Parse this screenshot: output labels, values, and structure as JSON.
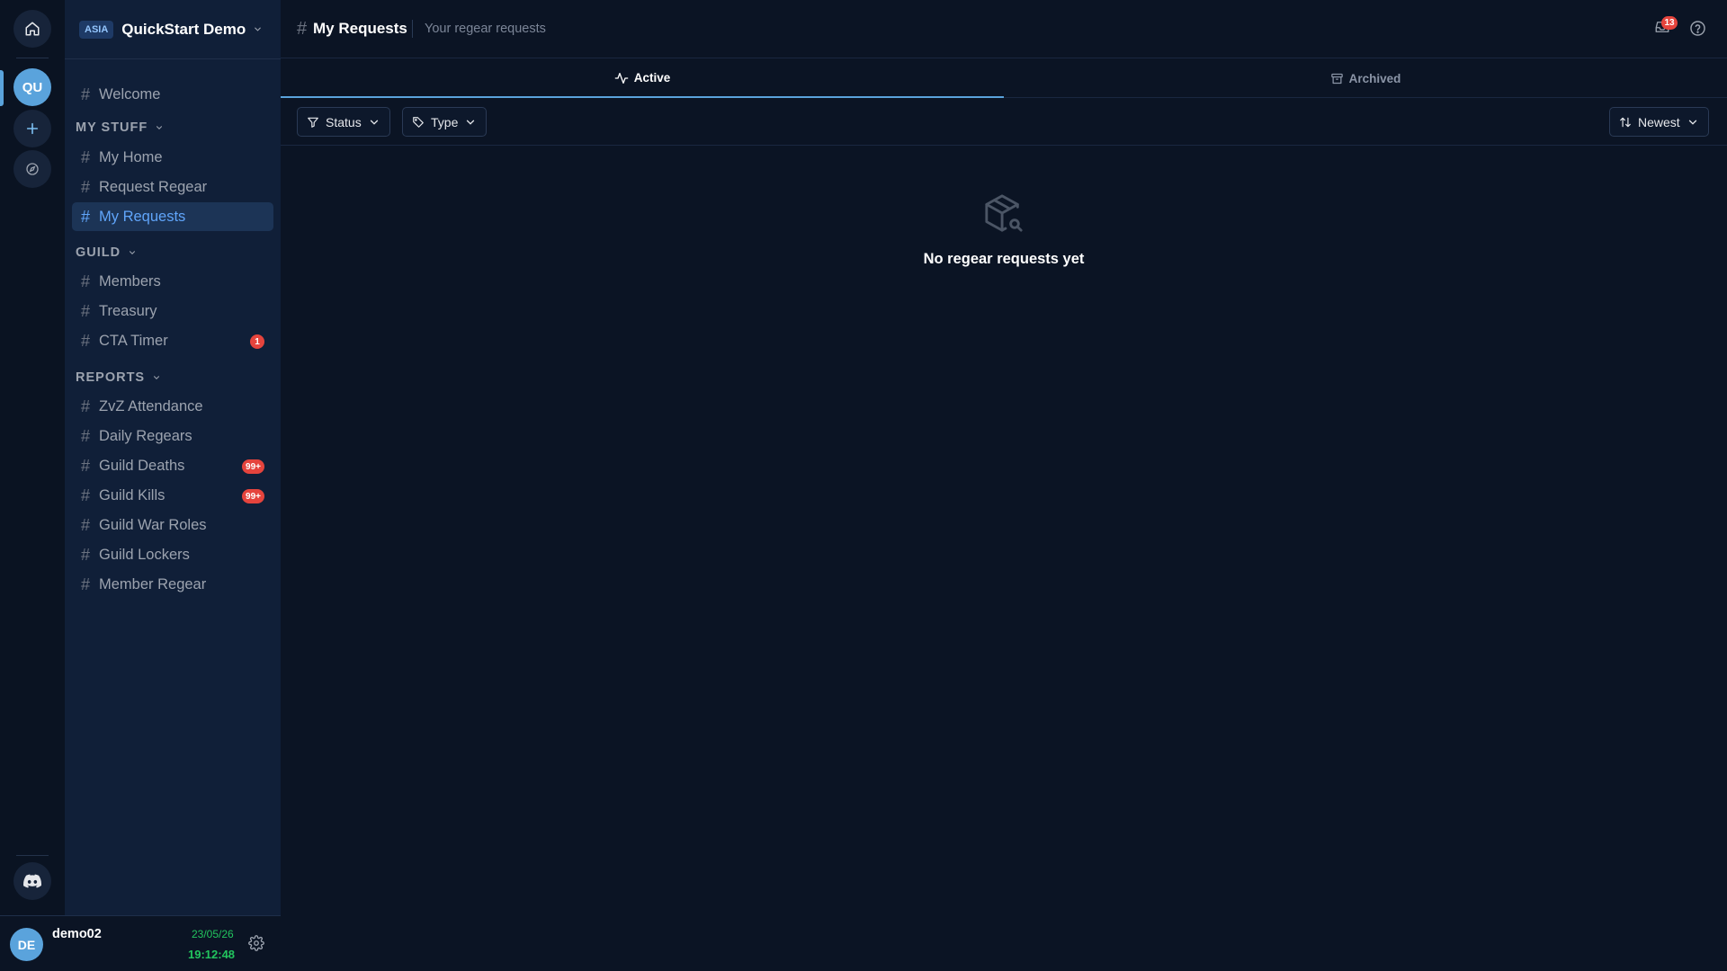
{
  "rail": {
    "server_initials": "QU"
  },
  "server": {
    "region": "ASIA",
    "name": "QuickStart Demo"
  },
  "nav": {
    "welcome": "Welcome",
    "sections": [
      {
        "title": "MY STUFF",
        "items": [
          {
            "label": "My Home"
          },
          {
            "label": "Request Regear"
          },
          {
            "label": "My Requests",
            "active": true
          }
        ]
      },
      {
        "title": "GUILD",
        "items": [
          {
            "label": "Members"
          },
          {
            "label": "Treasury"
          },
          {
            "label": "CTA Timer",
            "badge": "1"
          }
        ]
      },
      {
        "title": "REPORTS",
        "items": [
          {
            "label": "ZvZ Attendance"
          },
          {
            "label": "Daily Regears"
          },
          {
            "label": "Guild Deaths",
            "badge": "99+"
          },
          {
            "label": "Guild Kills",
            "badge": "99+"
          },
          {
            "label": "Guild War Roles"
          },
          {
            "label": "Guild Lockers"
          },
          {
            "label": "Member Regear"
          }
        ]
      }
    ]
  },
  "user": {
    "initials": "DE",
    "name": "demo02",
    "date": "23/05/26",
    "time": "19:12:48"
  },
  "header": {
    "title": "My Requests",
    "subtitle": "Your regear requests",
    "notification_count": "13"
  },
  "tabs": {
    "active": "Active",
    "archived": "Archived"
  },
  "filters": {
    "status": "Status",
    "type": "Type",
    "sort": "Newest"
  },
  "empty_state": {
    "title": "No regear requests yet"
  },
  "colors": {
    "accent": "#5aa3dc",
    "badge": "#e5443d",
    "clock": "#22c55e"
  }
}
